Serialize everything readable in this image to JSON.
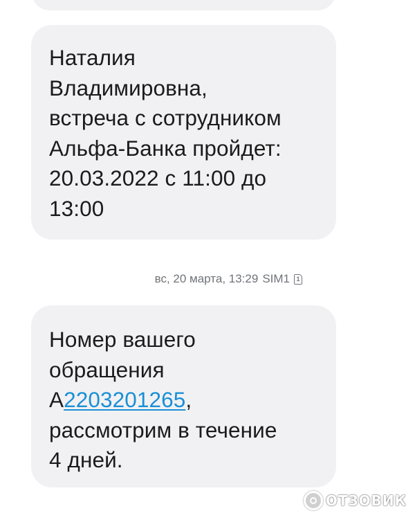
{
  "messages": [
    {
      "lines": [
        "Наталия",
        "Владимировна,",
        "встреча с сотрудником",
        "Альфа-Банка пройдет:",
        "20.03.2022 с 11:00 до",
        "13:00"
      ]
    },
    {
      "lines": [
        "Номер вашего",
        "обращения"
      ],
      "link_prefix": "А",
      "link_text": "2203201265",
      "link_suffix": ",",
      "lines_after": [
        "рассмотрим в течение",
        "4 дней."
      ]
    }
  ],
  "timestamp": {
    "text": "вс, 20 марта, 13:29",
    "sim_label": "SIM1",
    "sim_icon_digit": "1",
    "sim_icon": "sim-card-icon"
  },
  "watermark": {
    "text": "ОТЗОВИК",
    "icon": "otzovik-logo-icon"
  },
  "colors": {
    "bubble": "#f1f1f3",
    "link": "#1a8fd6",
    "meta_text": "#707378"
  }
}
